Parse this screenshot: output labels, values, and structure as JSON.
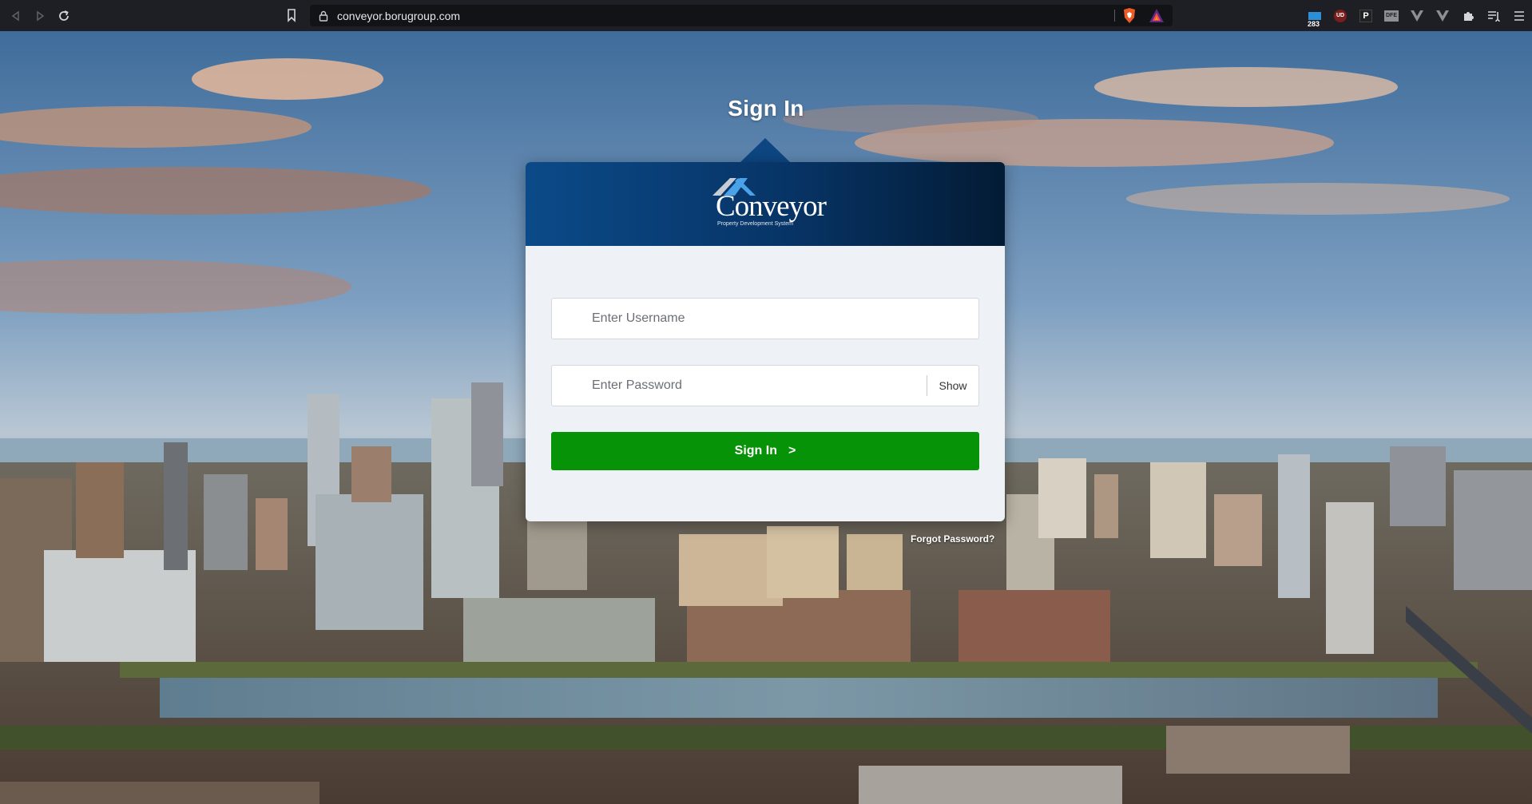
{
  "browser": {
    "url": "conveyor.borugroup.com",
    "extensions": {
      "ext1_badge": "283",
      "ext2_label": "UD",
      "ext3_label": "P",
      "ext4_label": "DFE"
    }
  },
  "signin": {
    "heading": "Sign In",
    "logo_text": "Conveyor",
    "logo_subtitle": "Property Development System",
    "username_placeholder": "Enter Username",
    "password_placeholder": "Enter Password",
    "show_label": "Show",
    "submit_label": "Sign In",
    "submit_arrow": ">",
    "forgot_label": "Forgot Password?"
  },
  "colors": {
    "header_blue": "#0b4a88",
    "submit_green": "#079307",
    "card_bg": "#eef1f5"
  }
}
